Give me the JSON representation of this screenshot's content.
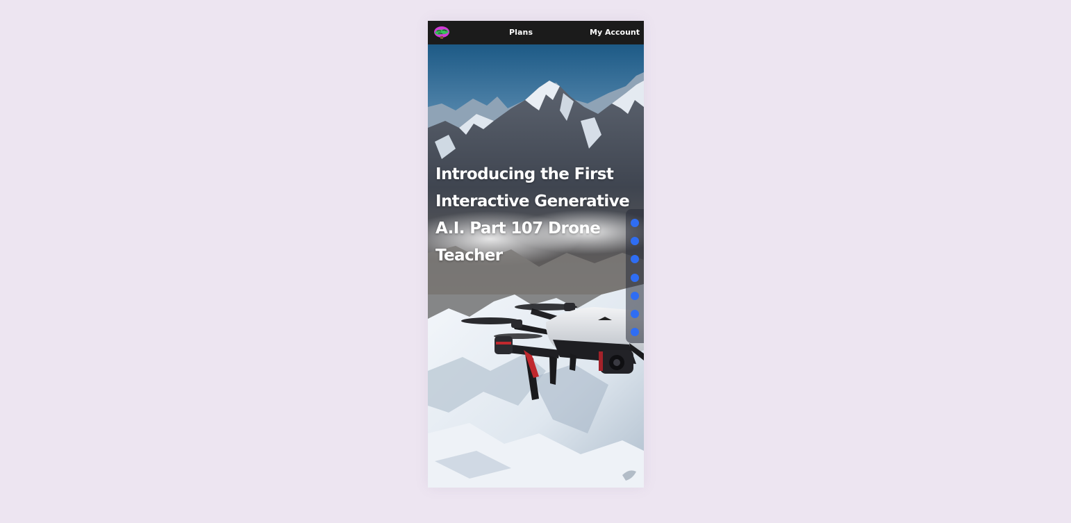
{
  "header": {
    "logo_icon": "brain-logo-icon",
    "nav": [
      {
        "label": "Plans"
      },
      {
        "label": "My Account"
      }
    ]
  },
  "hero": {
    "headline": "Introducing the First Interactive Generative A.I. Part 107 Drone Teacher",
    "background": "drone-over-snowy-mountains-image"
  },
  "slide_nav": {
    "dot_count": 7,
    "dot_color": "#2f6df3"
  },
  "colors": {
    "page_background": "#ede5f1",
    "topbar": "#1b1b1b",
    "accent": "#2f6df3"
  }
}
